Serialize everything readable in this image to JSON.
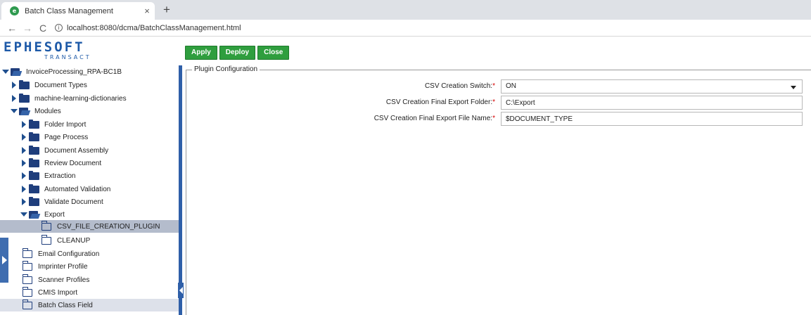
{
  "browser": {
    "tab_title": "Batch Class Management",
    "tab_close": "×",
    "new_tab": "+",
    "back": "←",
    "forward": "→",
    "reload": "C",
    "url": "localhost:8080/dcma/BatchClassManagement.html"
  },
  "logo": {
    "main": "EPHESOFT",
    "sub": "TRANSACT"
  },
  "toolbar": {
    "apply_label": "Apply",
    "deploy_label": "Deploy",
    "close_label": "Close"
  },
  "tree": {
    "root": "InvoiceProcessing_RPA-BC1B",
    "document_types": "Document Types",
    "ml_dictionaries": "machine-learning-dictionaries",
    "modules": "Modules",
    "folder_import": "Folder Import",
    "page_process": "Page Process",
    "document_assembly": "Document Assembly",
    "review_document": "Review Document",
    "extraction": "Extraction",
    "automated_validation": "Automated Validation",
    "validate_document": "Validate Document",
    "export": "Export",
    "csv_plugin": "CSV_FILE_CREATION_PLUGIN",
    "cleanup": "CLEANUP",
    "email_configuration": "Email Configuration",
    "imprinter_profile": "Imprinter Profile",
    "scanner_profiles": "Scanner Profiles",
    "cmis_import": "CMIS Import",
    "batch_class_field": "Batch Class Field"
  },
  "plugin": {
    "legend": "Plugin Configuration",
    "required_mark": "*",
    "switch_label": "CSV Creation Switch:",
    "switch_value": "ON",
    "folder_label": "CSV Creation Final Export Folder:",
    "folder_value": "C:\\Export",
    "filename_label": "CSV Creation Final Export File Name:",
    "filename_value": "$DOCUMENT_TYPE"
  },
  "colors": {
    "button_green": "#2f9e3e",
    "brand_blue": "#1e5aa8",
    "selection": "#b4bccc",
    "splitter": "#2f5fa8"
  }
}
